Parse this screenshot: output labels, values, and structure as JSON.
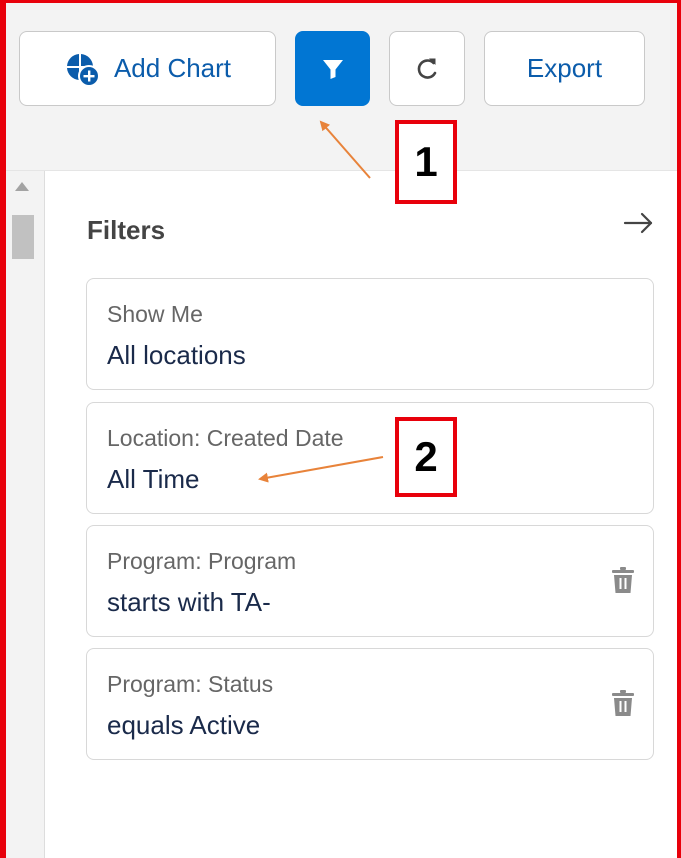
{
  "toolbar": {
    "add_chart_label": "Add Chart",
    "export_label": "Export",
    "add_chart_icon": "add-chart-icon",
    "filter_icon": "funnel-icon",
    "refresh_icon": "refresh-icon"
  },
  "annotations": {
    "callout_1": "1",
    "callout_2": "2",
    "color": "#e8000b",
    "arrow_color": "#e8833a"
  },
  "filters_panel": {
    "title": "Filters",
    "collapse_icon": "arrow-right-icon",
    "cards": [
      {
        "label": "Show Me",
        "value": "All locations",
        "deletable": false
      },
      {
        "label": "Location: Created Date",
        "value": "All Time",
        "deletable": false
      },
      {
        "label": "Program: Program",
        "value": "starts with TA-",
        "deletable": true
      },
      {
        "label": "Program: Status",
        "value": "equals Active",
        "deletable": true
      }
    ]
  },
  "colors": {
    "brand_blue": "#0176d3",
    "link_blue": "#0b5cab",
    "toolbar_bg": "#f3f3f3"
  }
}
